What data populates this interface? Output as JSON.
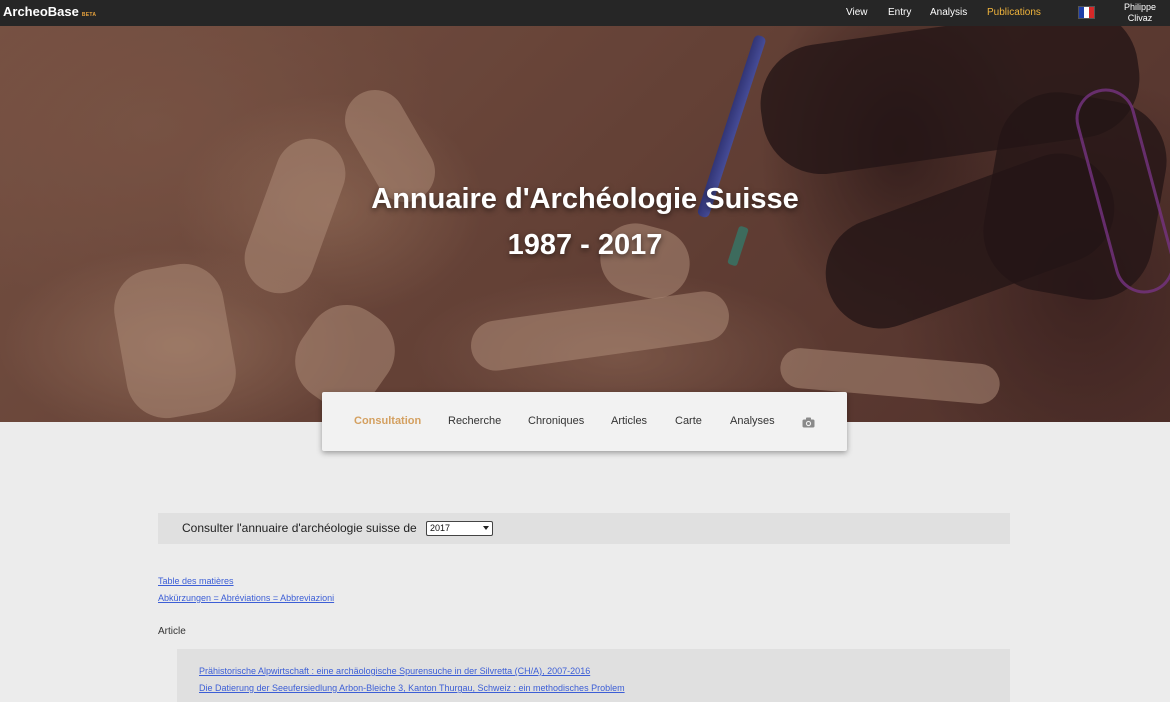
{
  "brand": {
    "name": "ArcheoBase",
    "badge": "BETA"
  },
  "nav": [
    {
      "label": "View"
    },
    {
      "label": "Entry"
    },
    {
      "label": "Analysis"
    },
    {
      "label": "Publications",
      "active": true
    }
  ],
  "language_flag": "flag-fr-icon",
  "user": {
    "first": "Philippe",
    "last": "Clivaz"
  },
  "hero": {
    "title": "Annuaire d'Archéologie Suisse",
    "years": "1987 - 2017"
  },
  "tabs": [
    {
      "label": "Consultation",
      "active": true
    },
    {
      "label": "Recherche"
    },
    {
      "label": "Chroniques"
    },
    {
      "label": "Articles"
    },
    {
      "label": "Carte"
    },
    {
      "label": "Analyses"
    }
  ],
  "gallery_icon": "camera-icon",
  "year_selector": {
    "label": "Consulter l'annuaire d'archéologie suisse de",
    "selected": "2017"
  },
  "links": {
    "toc": "Table des matières",
    "abbrev": "Abkürzungen = Abréviations = Abbreviazioni"
  },
  "section": {
    "label": "Article"
  },
  "articles": [
    "Prähistorische Alpwirtschaft : eine archäologische Spurensuche in der Silvretta (CH/A), 2007-2016",
    "Die Datierung der Seeufersiedlung Arbon-Bleiche 3, Kanton Thurgau, Schweiz : ein methodisches Problem"
  ],
  "colors": {
    "topbar": "#262626",
    "accent_nav": "#f0b43c",
    "accent_tab": "#d4a060",
    "link": "#3c5ed6",
    "page_bg": "#ececec"
  }
}
